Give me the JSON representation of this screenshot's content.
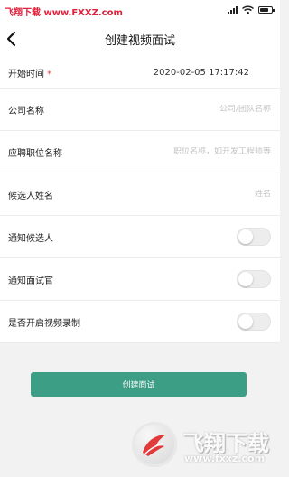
{
  "statusbar": {
    "watermark": "飞翔下载 www.FXXZ.com"
  },
  "navbar": {
    "title": "创建视频面试"
  },
  "form": {
    "start_time": {
      "label": "开始时间",
      "required_mark": "*",
      "value": "2020-02-05 17:17:42"
    },
    "company": {
      "label": "公司名称",
      "placeholder": "公司/团队名称"
    },
    "position": {
      "label": "应聘职位名称",
      "placeholder": "职位名称，如开发工程师等"
    },
    "candidate": {
      "label": "候选人姓名",
      "placeholder": "姓名"
    },
    "notify_candidate": {
      "label": "通知候选人",
      "enabled": false
    },
    "notify_interviewer": {
      "label": "通知面试官",
      "enabled": false
    },
    "record_video": {
      "label": "是否开启视频录制",
      "enabled": false
    }
  },
  "actions": {
    "create_label": "创建面试"
  },
  "colors": {
    "accent": "#3d9e86",
    "required": "#e5484d",
    "watermark": "#e0203a"
  },
  "watermark_bottom": {
    "brand": "飞翔下载",
    "url": "www.fxxz.com"
  }
}
